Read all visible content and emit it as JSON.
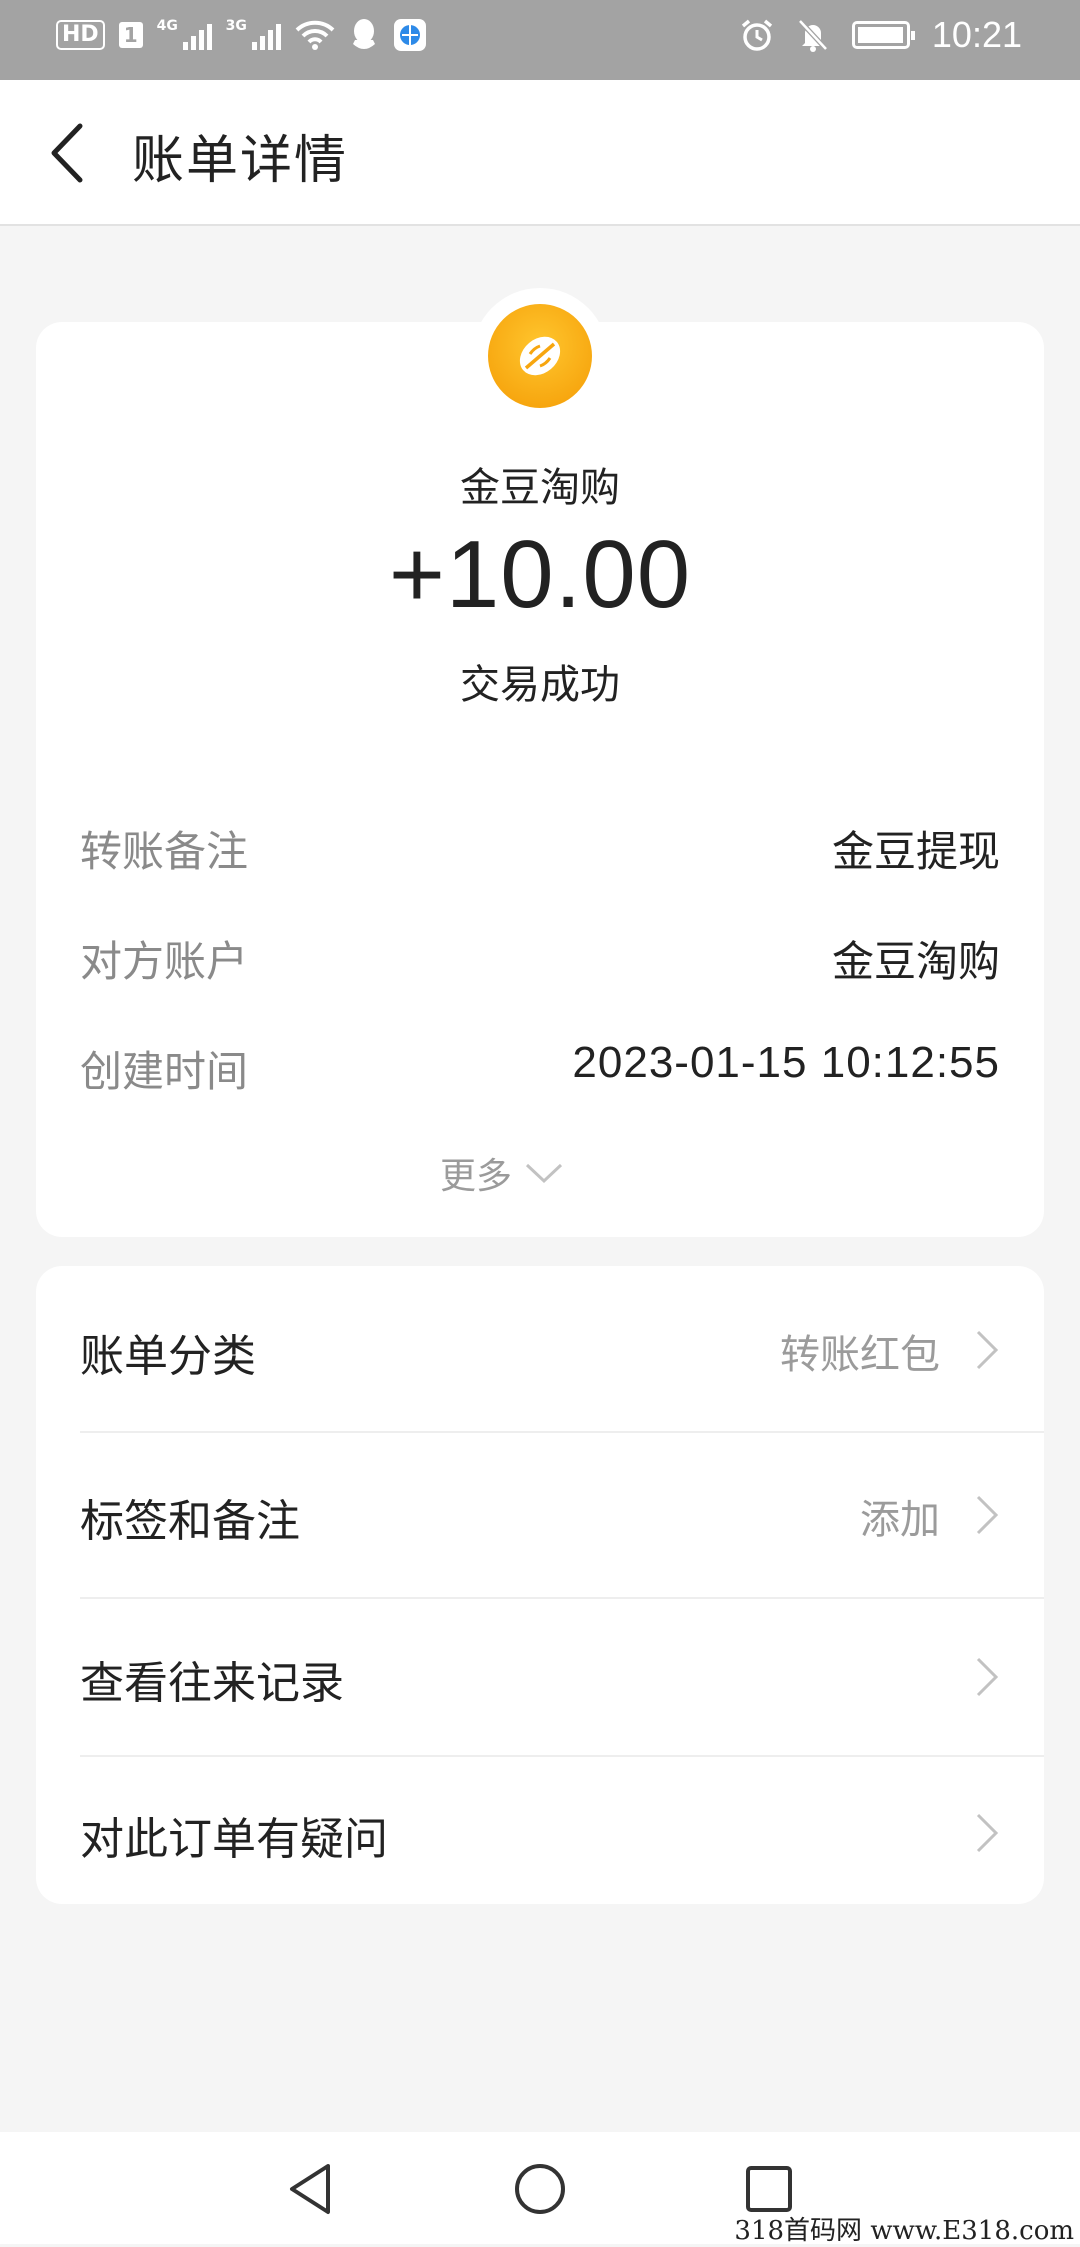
{
  "status_bar": {
    "hd_label": "HD",
    "sim_label": "1",
    "signal1_tag": "4G",
    "signal2_tag": "3G",
    "time": "10:21",
    "icons": [
      "signal-icon",
      "wifi-icon",
      "qq-icon",
      "browser-icon",
      "alarm-icon",
      "mute-icon",
      "battery-icon"
    ]
  },
  "header": {
    "title": "账单详情",
    "back_icon": "chevron-left-icon"
  },
  "transaction": {
    "merchant_name": "金豆淘购",
    "amount": "+10.00",
    "status": "交易成功",
    "logo_icon": "golden-bean-icon"
  },
  "details": [
    {
      "label": "转账备注",
      "value": "金豆提现"
    },
    {
      "label": "对方账户",
      "value": "金豆淘购"
    },
    {
      "label": "创建时间",
      "value": "2023-01-15 10:12:55"
    }
  ],
  "more": {
    "label": "更多",
    "icon": "chevron-down-icon"
  },
  "menu": [
    {
      "label": "账单分类",
      "value": "转账红包"
    },
    {
      "label": "标签和备注",
      "value": "添加"
    },
    {
      "label": "查看往来记录",
      "value": ""
    },
    {
      "label": "对此订单有疑问",
      "value": ""
    }
  ],
  "system_nav": {
    "icons": [
      "back-triangle-icon",
      "home-circle-icon",
      "recents-square-icon"
    ]
  },
  "watermark": "318首码网 www.E318.com",
  "colors": {
    "status_bar": "#a3a3a3",
    "logo": "#f7a60f",
    "muted_text": "#8a8a8a",
    "background": "#f5f5f5"
  }
}
